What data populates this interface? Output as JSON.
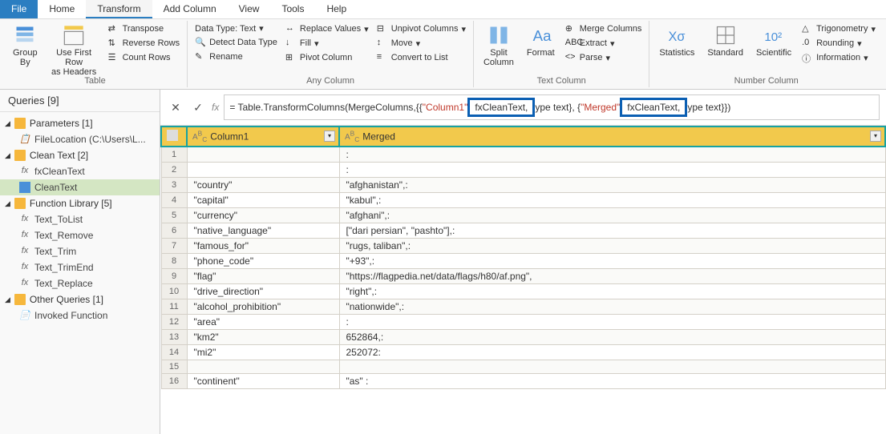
{
  "menu": {
    "file": "File",
    "tabs": [
      "Home",
      "Transform",
      "Add Column",
      "View",
      "Tools",
      "Help"
    ],
    "active": "Transform"
  },
  "ribbon": {
    "table": {
      "label": "Table",
      "groupBy": "Group\nBy",
      "useFirstRow": "Use First Row\nas Headers",
      "transpose": "Transpose",
      "reverseRows": "Reverse Rows",
      "countRows": "Count Rows"
    },
    "anyColumn": {
      "label": "Any Column",
      "dataType": "Data Type: Text",
      "detect": "Detect Data Type",
      "rename": "Rename",
      "replaceValues": "Replace Values",
      "fill": "Fill",
      "pivot": "Pivot Column",
      "unpivot": "Unpivot Columns",
      "move": "Move",
      "convertList": "Convert to List"
    },
    "textColumn": {
      "label": "Text Column",
      "split": "Split\nColumn",
      "format": "Format",
      "merge": "Merge Columns",
      "extract": "Extract",
      "parse": "Parse"
    },
    "numberColumn": {
      "label": "Number Column",
      "statistics": "Statistics",
      "standard": "Standard",
      "scientific": "Scientific",
      "trig": "Trigonometry",
      "rounding": "Rounding",
      "info": "Information"
    }
  },
  "sidebar": {
    "header": "Queries [9]",
    "groups": [
      {
        "label": "Parameters [1]",
        "items": [
          {
            "icon": "param",
            "label": "FileLocation (C:\\Users\\L..."
          }
        ]
      },
      {
        "label": "Clean Text [2]",
        "items": [
          {
            "icon": "fx",
            "label": "fxCleanText"
          },
          {
            "icon": "tbl",
            "label": "CleanText",
            "selected": true
          }
        ]
      },
      {
        "label": "Function Library [5]",
        "items": [
          {
            "icon": "fx",
            "label": "Text_ToList"
          },
          {
            "icon": "fx",
            "label": "Text_Remove"
          },
          {
            "icon": "fx",
            "label": "Text_Trim"
          },
          {
            "icon": "fx",
            "label": "Text_TrimEnd"
          },
          {
            "icon": "fx",
            "label": "Text_Replace"
          }
        ]
      },
      {
        "label": "Other Queries [1]",
        "items": [
          {
            "icon": "doc",
            "label": "Invoked Function"
          }
        ]
      }
    ]
  },
  "formula": {
    "prefix": "= Table.TransformColumns(MergeColumns,{{",
    "str1": "\"Column1\"",
    "hl1": "fxCleanText,",
    "mid1": "ype text}, {",
    "str2": "\"Merged\"",
    "hl2": "fxCleanText,",
    "end": "ype text}})"
  },
  "grid": {
    "columns": [
      "Column1",
      "Merged"
    ],
    "rows": [
      {
        "n": "1",
        "c1": "",
        "c2": ":"
      },
      {
        "n": "2",
        "c1": "",
        "c2": ":"
      },
      {
        "n": "3",
        "c1": "\"country\"",
        "c2": "\"afghanistan\",:"
      },
      {
        "n": "4",
        "c1": "\"capital\"",
        "c2": "\"kabul\",:"
      },
      {
        "n": "5",
        "c1": "\"currency\"",
        "c2": "\"afghani\",:"
      },
      {
        "n": "6",
        "c1": "\"native_language\"",
        "c2": "[\"dari persian\", \"pashto\"],:"
      },
      {
        "n": "7",
        "c1": "\"famous_for\"",
        "c2": "\"rugs, taliban\",:"
      },
      {
        "n": "8",
        "c1": "\"phone_code\"",
        "c2": "\"+93\",:"
      },
      {
        "n": "9",
        "c1": "\"flag\"",
        "c2": "\"https://flagpedia.net/data/flags/h80/af.png\","
      },
      {
        "n": "10",
        "c1": "\"drive_direction\"",
        "c2": "\"right\",:"
      },
      {
        "n": "11",
        "c1": "\"alcohol_prohibition\"",
        "c2": "\"nationwide\",:"
      },
      {
        "n": "12",
        "c1": "\"area\"",
        "c2": ":"
      },
      {
        "n": "13",
        "c1": "  \"km2\"",
        "c2": "652864,:"
      },
      {
        "n": "14",
        "c1": "  \"mi2\"",
        "c2": "252072:"
      },
      {
        "n": "15",
        "c1": "",
        "c2": ""
      },
      {
        "n": "16",
        "c1": "\"continent\"",
        "c2": "\"as\" :"
      }
    ]
  }
}
